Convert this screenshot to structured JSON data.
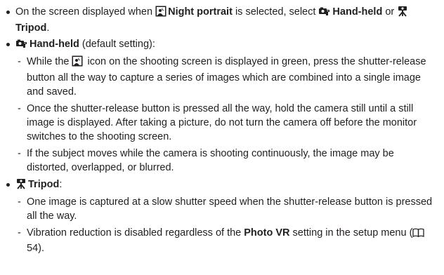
{
  "bullets": [
    {
      "p1": "On the screen displayed when ",
      "b1": "Night portrait",
      "p2": " is selected, select ",
      "b2": "Hand-held",
      "p3": " or ",
      "b3": "Tripod",
      "p4": "."
    },
    {
      "title": "Hand-held",
      "suffix": " (default setting):",
      "items": [
        {
          "p1": "While the ",
          "p2": " icon on the shooting screen is displayed in green, press the shutter-release button all the way to capture a series of images which are combined into a single image and saved."
        },
        {
          "text": "Once the shutter-release button is pressed all the way, hold the camera still until a still image is displayed. After taking a picture, do not turn the camera off before the monitor switches to the shooting screen."
        },
        {
          "text": "If the subject moves while the camera is shooting continuously, the image may be distorted, overlapped, or blurred."
        }
      ]
    },
    {
      "title": "Tripod",
      "suffix": ":",
      "items": [
        {
          "text": "One image is captured at a slow shutter speed when the shutter-release button is pressed all the way."
        },
        {
          "p1": "Vibration reduction is disabled regardless of the ",
          "b1": "Photo VR",
          "p2": " setting in the setup menu (",
          "page": "54",
          "p3": ")."
        }
      ]
    }
  ],
  "icons": {
    "night_portrait": "night-portrait-icon",
    "hand_held": "hand-held-icon",
    "tripod": "tripod-icon",
    "reference": "page-reference-icon"
  }
}
